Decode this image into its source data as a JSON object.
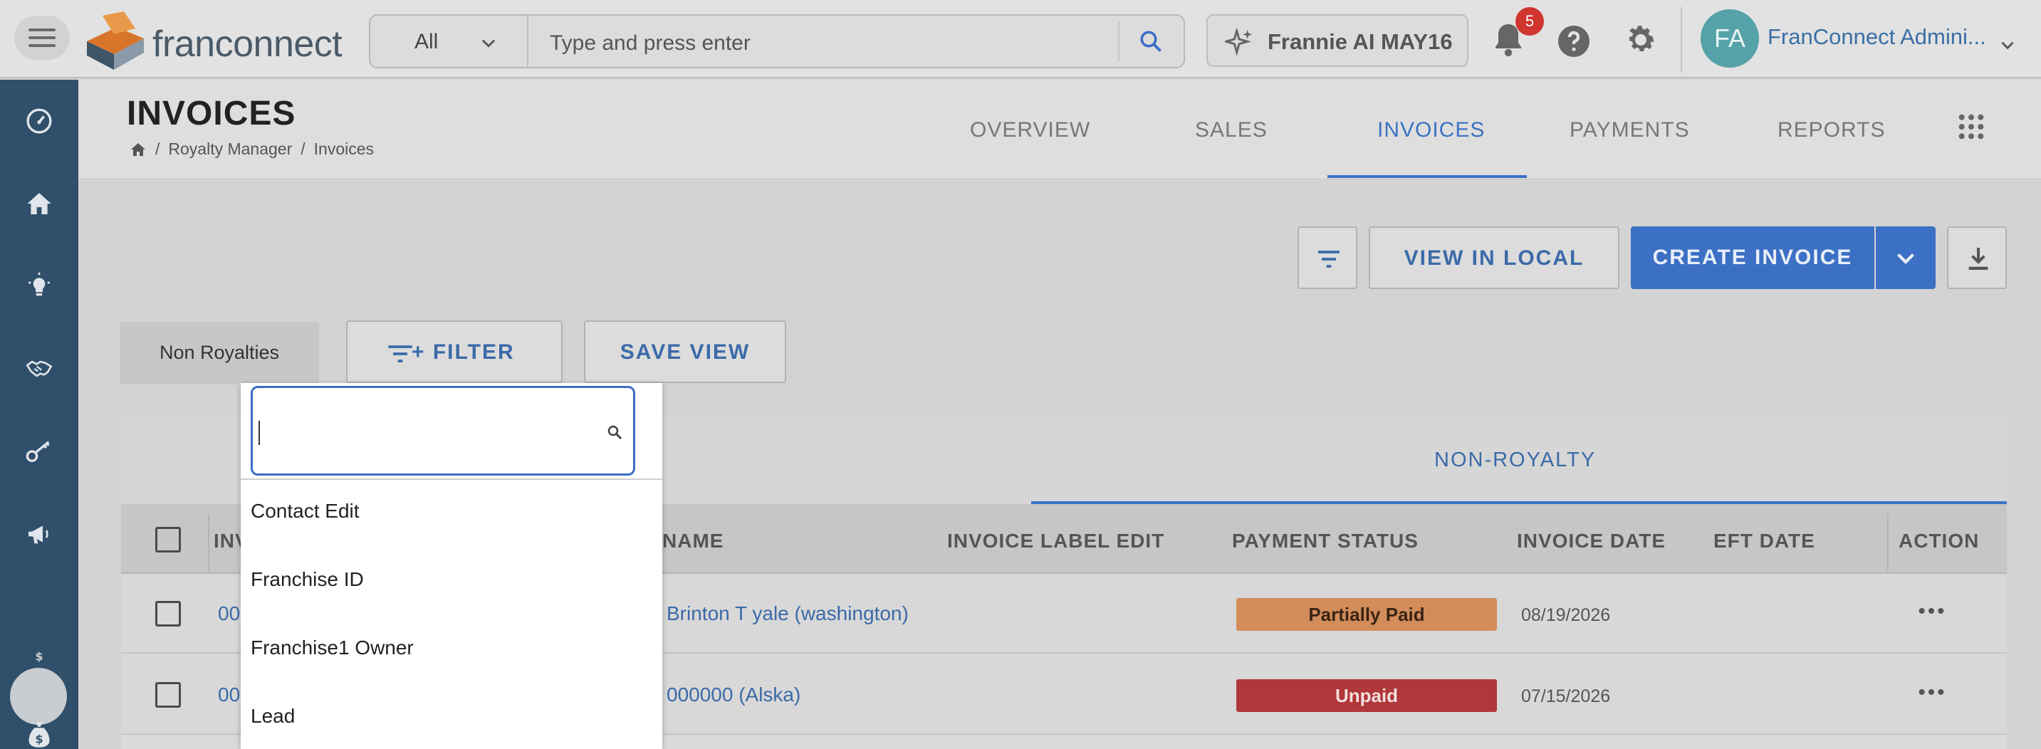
{
  "topbar": {
    "logo_text": "franconnect",
    "search_scope": "All",
    "search_placeholder": "Type and press enter",
    "ai_button_label": "Frannie AI MAY16",
    "notification_count": "5",
    "avatar_initials": "FA",
    "user_name": "FranConnect Admini..."
  },
  "sidebar": {
    "items": [
      "dashboard-icon",
      "home-icon",
      "lightbulb-icon",
      "handshake-icon",
      "key-icon",
      "megaphone-icon",
      "royalty-bag-icon",
      "money-bag-icon"
    ],
    "active_index": 6
  },
  "header": {
    "title": "INVOICES",
    "breadcrumb": [
      "Royalty Manager",
      "Invoices"
    ],
    "tabs": [
      {
        "label": "OVERVIEW",
        "active": false
      },
      {
        "label": "SALES",
        "active": false
      },
      {
        "label": "INVOICES",
        "active": true
      },
      {
        "label": "PAYMENTS",
        "active": false
      },
      {
        "label": "REPORTS",
        "active": false
      }
    ]
  },
  "actions": {
    "view_local": "VIEW IN LOCAL",
    "create_invoice": "CREATE INVOICE"
  },
  "filters": {
    "view_chip": "Non Royalties",
    "filter_button": "+ FILTER",
    "save_view": "SAVE VIEW"
  },
  "table": {
    "subtab": "NON-ROYALTY",
    "columns": {
      "invoice": "INV",
      "name": "NAME",
      "invoice_label": "INVOICE LABEL EDIT",
      "payment_status": "PAYMENT STATUS",
      "invoice_date": "INVOICE DATE",
      "eft_date": "EFT DATE",
      "action": "ACTION"
    },
    "rows": [
      {
        "invoice": "00",
        "name": "Brinton T yale (washington)",
        "status": "Partially Paid",
        "date": "08/19/2026"
      },
      {
        "invoice": "00",
        "name": "000000 (Alska)",
        "status": "Unpaid",
        "date": "07/15/2026"
      }
    ]
  },
  "dropdown": {
    "search_value": "",
    "items": [
      "Contact Edit",
      "Franchise ID",
      "Franchise1 Owner",
      "Lead"
    ]
  },
  "colors": {
    "accent": "#3b73c4",
    "sidebar": "#2f4f6a",
    "partial_paid": "#d28d5a",
    "unpaid": "#b0373a"
  }
}
